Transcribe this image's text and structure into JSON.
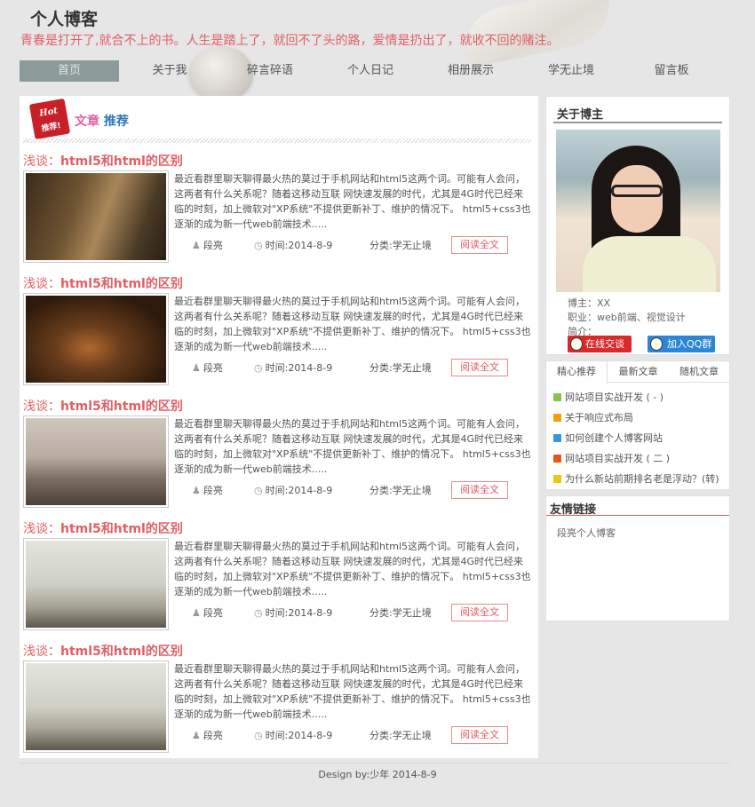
{
  "header": {
    "site_title": "个人博客",
    "motto": "青春是打开了,就合不上的书。人生是踏上了，就回不了头的路，爱情是扔出了，就收不回的赌注。"
  },
  "nav": [
    {
      "label": "首页",
      "active": true
    },
    {
      "label": "关于我",
      "active": false
    },
    {
      "label": "碎言碎语",
      "active": false
    },
    {
      "label": "个人日记",
      "active": false
    },
    {
      "label": "相册展示",
      "active": false
    },
    {
      "label": "学无止境",
      "active": false
    },
    {
      "label": "留言板",
      "active": false
    }
  ],
  "recommend": {
    "badge_top": "Hot",
    "badge_bottom": "推荐!",
    "title_a": "文章",
    "title_b": "推荐"
  },
  "articles": [
    {
      "title_prefix": "浅谈：",
      "title": "html5和html的区别",
      "excerpt": "最近看群里聊天聊得最火热的莫过于手机网站和html5这两个词。可能有人会问，这两者有什么关系呢？随着这移动互联 网快速发展的时代，尤其是4G时代已经来临的时刻，加上微软对\"XP系统\"不提供更新补丁、维护的情况下。 html5+css3也逐渐的成为新一代web前端技术.....",
      "author": "段亮",
      "time": "时间:2014-8-9",
      "category": "分类:学无止境",
      "read_more": "阅读全文"
    },
    {
      "title_prefix": "浅谈：",
      "title": "html5和html的区别",
      "excerpt": "最近看群里聊天聊得最火热的莫过于手机网站和html5这两个词。可能有人会问，这两者有什么关系呢？随着这移动互联 网快速发展的时代，尤其是4G时代已经来临的时刻，加上微软对\"XP系统\"不提供更新补丁、维护的情况下。 html5+css3也逐渐的成为新一代web前端技术.....",
      "author": "段亮",
      "time": "时间:2014-8-9",
      "category": "分类:学无止境",
      "read_more": "阅读全文"
    },
    {
      "title_prefix": "浅谈：",
      "title": "html5和html的区别",
      "excerpt": "最近看群里聊天聊得最火热的莫过于手机网站和html5这两个词。可能有人会问，这两者有什么关系呢？随着这移动互联 网快速发展的时代，尤其是4G时代已经来临的时刻，加上微软对\"XP系统\"不提供更新补丁、维护的情况下。 html5+css3也逐渐的成为新一代web前端技术.....",
      "author": "段亮",
      "time": "时间:2014-8-9",
      "category": "分类:学无止境",
      "read_more": "阅读全文"
    },
    {
      "title_prefix": "浅谈：",
      "title": "html5和html的区别",
      "excerpt": "最近看群里聊天聊得最火热的莫过于手机网站和html5这两个词。可能有人会问，这两者有什么关系呢？随着这移动互联 网快速发展的时代，尤其是4G时代已经来临的时刻，加上微软对\"XP系统\"不提供更新补丁、维护的情况下。 html5+css3也逐渐的成为新一代web前端技术.....",
      "author": "段亮",
      "time": "时间:2014-8-9",
      "category": "分类:学无止境",
      "read_more": "阅读全文"
    },
    {
      "title_prefix": "浅谈：",
      "title": "html5和html的区别",
      "excerpt": "最近看群里聊天聊得最火热的莫过于手机网站和html5这两个词。可能有人会问，这两者有什么关系呢？随着这移动互联 网快速发展的时代，尤其是4G时代已经来临的时刻，加上微软对\"XP系统\"不提供更新补丁、维护的情况下。 html5+css3也逐渐的成为新一代web前端技术.....",
      "author": "段亮",
      "time": "时间:2014-8-9",
      "category": "分类:学无止境",
      "read_more": "阅读全文"
    }
  ],
  "about": {
    "title": "关于博主",
    "name": "博主：XX",
    "job": "职业：web前端、视觉设计",
    "intro": "简介：",
    "chat_button": "在线交谈",
    "qq_button": "加入QQ群"
  },
  "tabs": {
    "labels": [
      "精心推荐",
      "最新文章",
      "随机文章"
    ],
    "items": [
      {
        "text": "网站项目实战开发 ( - )",
        "color": "#8bc34a"
      },
      {
        "text": "关于响应式布局",
        "color": "#f39c12"
      },
      {
        "text": "如何创建个人博客网站",
        "color": "#3498db"
      },
      {
        "text": "网站项目实战开发 ( 二 )",
        "color": "#e8541c"
      },
      {
        "text": "为什么新站前期排名老是浮动？(转)",
        "color": "#f1c40f"
      }
    ]
  },
  "links": {
    "title": "友情链接",
    "items": [
      "段亮个人博客"
    ]
  },
  "footer": {
    "text": "Design by:少年 2014-8-9"
  },
  "colors": {
    "accent_red": "#e15f63",
    "nav_active": "#8a9b9a",
    "page_bg": "#e6e6e6"
  }
}
